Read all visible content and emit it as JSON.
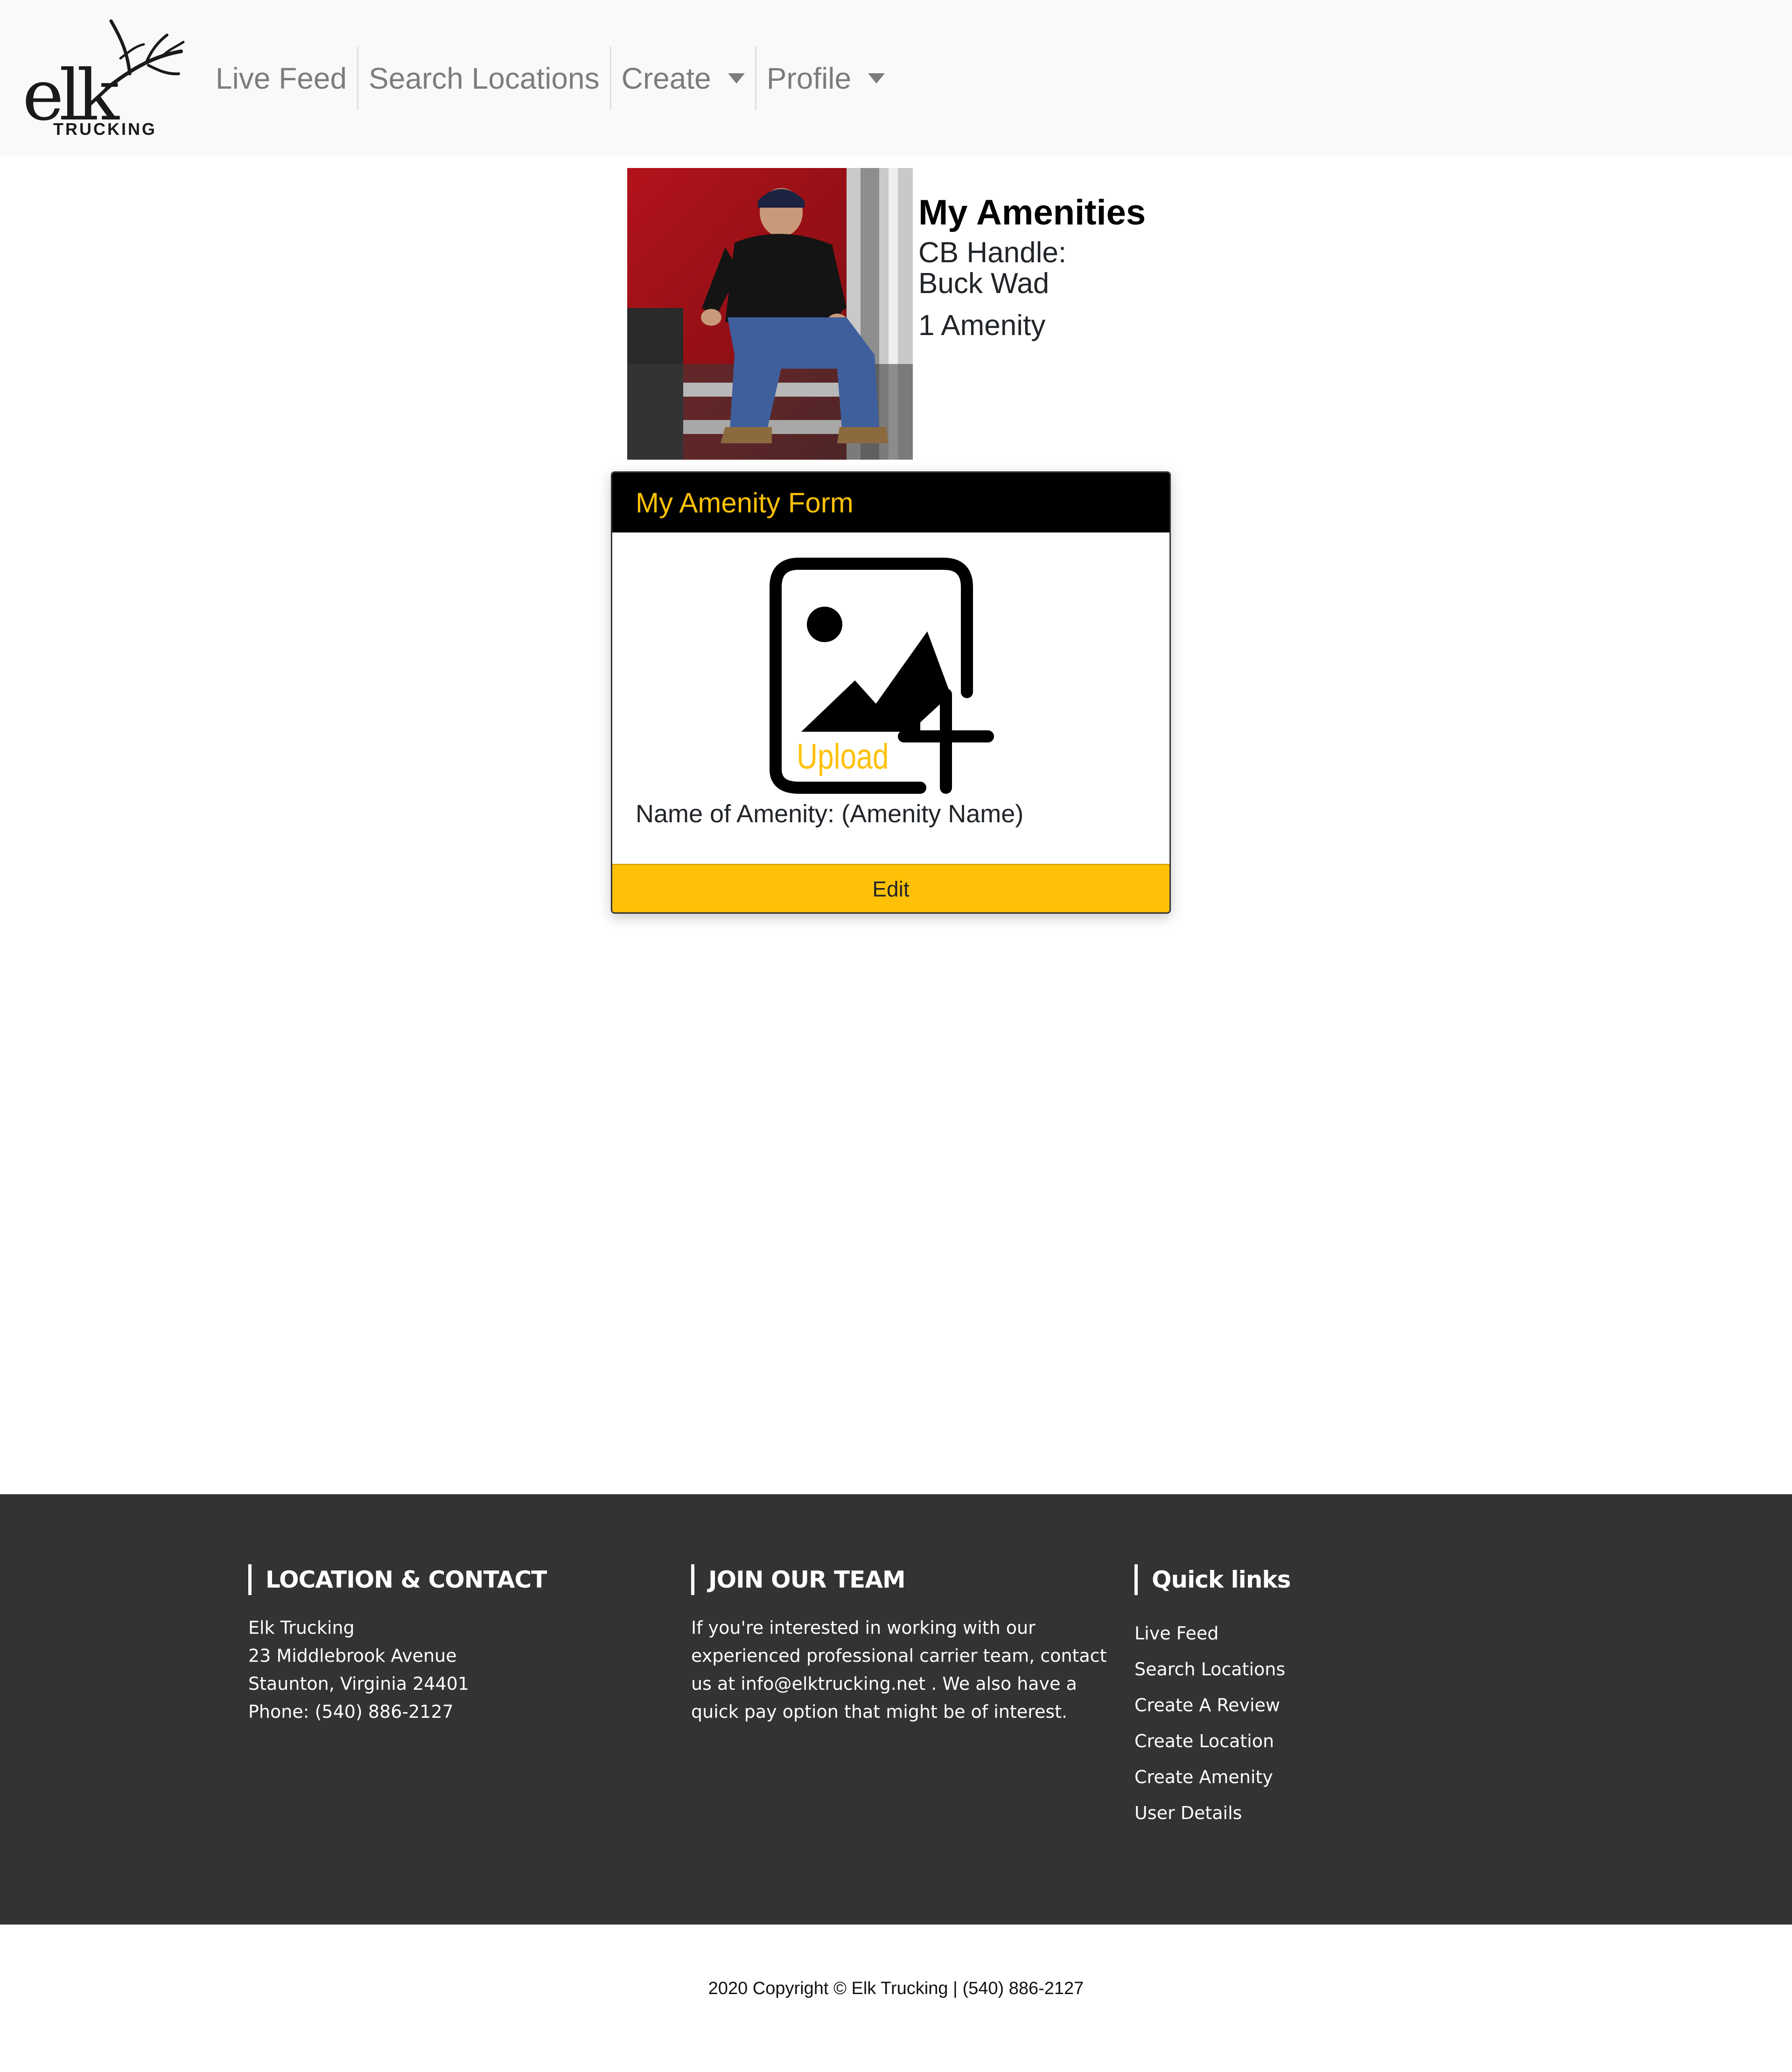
{
  "brand": {
    "name": "elk",
    "tagline": "TRUCKING"
  },
  "nav": {
    "live_feed": "Live Feed",
    "search_locations": "Search Locations",
    "create": "Create",
    "profile": "Profile"
  },
  "profile": {
    "title": "My Amenities",
    "cb_handle_label": "CB Handle:",
    "cb_handle": "Buck Wad",
    "amenity_count": "1 Amenity"
  },
  "card": {
    "header": "My Amenity Form",
    "upload_label": "Upload",
    "amenity_name": "Name of Amenity: (Amenity Name)",
    "edit_label": "Edit"
  },
  "footer": {
    "location": {
      "heading": "LOCATION & CONTACT",
      "lines": [
        "Elk Trucking",
        "23 Middlebrook Avenue",
        "Staunton, Virginia 24401",
        "Phone: (540) 886-2127"
      ]
    },
    "join": {
      "heading": "JOIN OUR TEAM",
      "lines": [
        "If you're interested in working with our",
        "experienced professional carrier team, contact",
        "us at info@elktrucking.net . We also have a",
        "quick pay option that might be of interest."
      ]
    },
    "quick_links": {
      "heading": "Quick links",
      "items": [
        "Live Feed",
        "Search Locations",
        "Create A Review",
        "Create Location",
        "Create Amenity",
        "User Details"
      ]
    }
  },
  "copyright": "2020 Copyright © Elk Trucking | (540) 886-2127",
  "colors": {
    "accent": "#ffc107",
    "footer_bg": "#333333",
    "navbar_bg": "#f8f9fa"
  }
}
